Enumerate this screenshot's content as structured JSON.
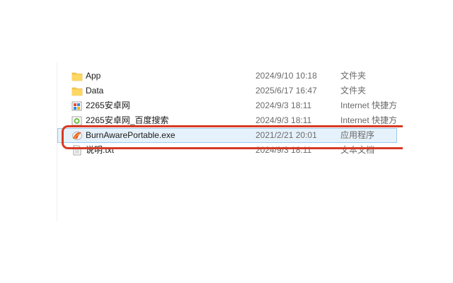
{
  "files": [
    {
      "name": "App",
      "date": "2024/9/10 10:18",
      "type": "文件夹",
      "icon": "folder-icon"
    },
    {
      "name": "Data",
      "date": "2025/6/17 16:47",
      "type": "文件夹",
      "icon": "folder-icon"
    },
    {
      "name": "2265安卓网",
      "date": "2024/9/3 18:11",
      "type": "Internet 快捷方",
      "icon": "internet-shortcut-icon"
    },
    {
      "name": "2265安卓网_百度搜索",
      "date": "2024/9/3 18:11",
      "type": "Internet 快捷方",
      "icon": "internet-shortcut-search-icon"
    },
    {
      "name": "BurnAwarePortable.exe",
      "date": "2021/2/21 20:01",
      "type": "应用程序",
      "icon": "burnaware-app-icon"
    },
    {
      "name": "说明.txt",
      "date": "2024/9/3 18:11",
      "type": "文本文档",
      "icon": "text-document-icon"
    }
  ],
  "colors": {
    "folder": "#f7c948",
    "highlight_border": "#d63a25",
    "selection_bg": "#e6f2fb"
  }
}
